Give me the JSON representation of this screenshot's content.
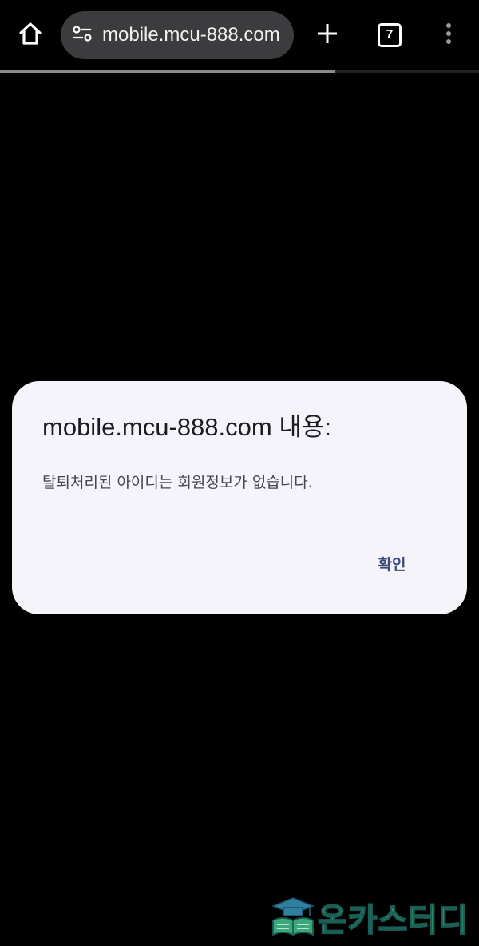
{
  "browser": {
    "url": "mobile.mcu-888.com",
    "tab_count": "7",
    "load_progress": 0.7
  },
  "dialog": {
    "title": "mobile.mcu-888.com 내용:",
    "message": "탈퇴처리된 아이디는 회원정보가 없습니다.",
    "confirm_label": "확인"
  },
  "watermark": {
    "text": "온카스터디",
    "colors": {
      "primary": "#3aa87a",
      "outline": "#1a5e55"
    }
  },
  "icons": {
    "home": "home-icon",
    "site_settings": "tune-icon",
    "new_tab": "plus-icon",
    "tabs": "tab-switcher-icon",
    "menu": "more-vert-icon"
  },
  "colors": {
    "background": "#000000",
    "urlbar": "#3c3c3f",
    "dialog_bg": "#f6f4fb",
    "dialog_button": "#3b4a7a"
  }
}
